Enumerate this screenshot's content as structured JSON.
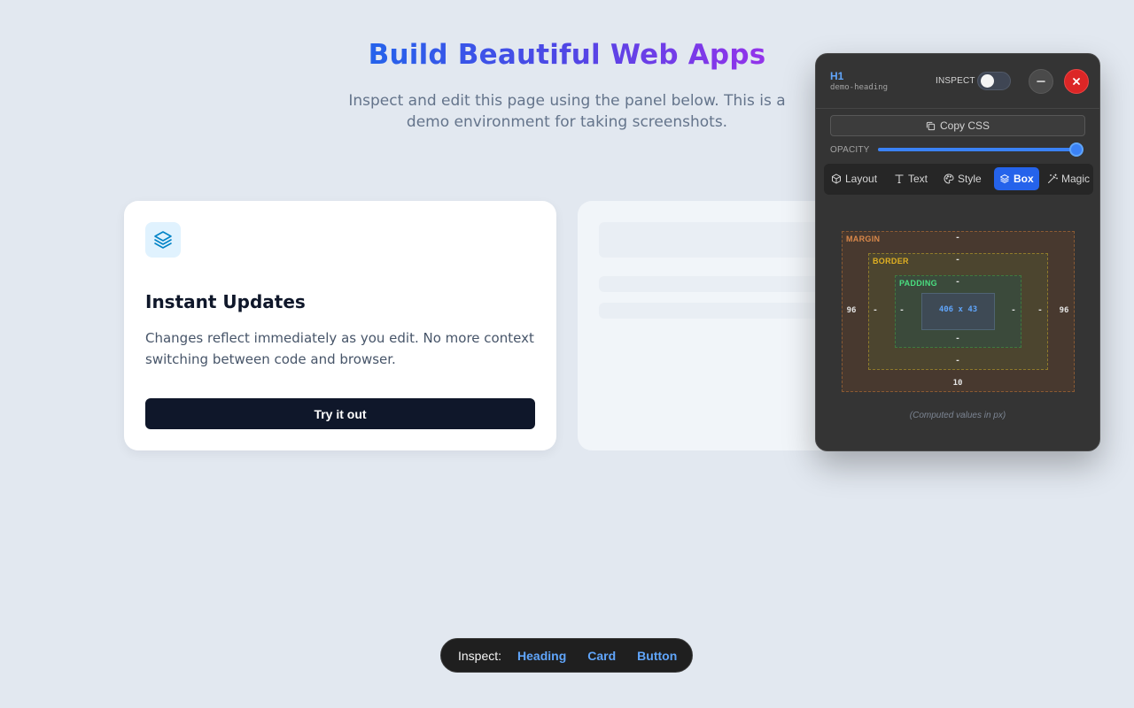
{
  "hero": {
    "title": "Build Beautiful Web Apps",
    "subtitle": "Inspect and edit this page using the panel below. This is a demo environment for taking screenshots."
  },
  "card": {
    "icon": "layers-icon",
    "title": "Instant Updates",
    "text": "Changes reflect immediately as you edit. No more context switching between code and browser.",
    "button_label": "Try it out"
  },
  "inspector": {
    "element_tag": "H1",
    "element_id": "demo-heading",
    "inspect_label": "INSPECT",
    "inspect_enabled": false,
    "copy_css_label": "Copy CSS",
    "opacity_label": "OPACITY",
    "opacity_value": 1.0,
    "tabs": [
      {
        "label": "Layout",
        "icon": "cube-icon",
        "active": false
      },
      {
        "label": "Text",
        "icon": "type-icon",
        "active": false
      },
      {
        "label": "Style",
        "icon": "palette-icon",
        "active": false
      },
      {
        "label": "Box",
        "icon": "layers-icon",
        "active": true
      },
      {
        "label": "Magic",
        "icon": "wand-icon",
        "active": false
      }
    ],
    "box_model": {
      "margin_label": "MARGIN",
      "border_label": "BORDER",
      "padding_label": "PADDING",
      "margin": {
        "top": "-",
        "right": "96",
        "bottom": "10",
        "left": "96"
      },
      "border": {
        "top": "-",
        "right": "-",
        "bottom": "-",
        "left": "-"
      },
      "padding": {
        "top": "-",
        "right": "-",
        "bottom": "-",
        "left": "-"
      },
      "content": "406 x 43",
      "note": "(Computed values in px)"
    },
    "colors": {
      "accent": "#2563eb",
      "margin": "#d9884a",
      "border": "#e0b022",
      "padding": "#4ade80",
      "content": "#60a5fa",
      "close": "#dc2626"
    }
  },
  "bottom_bar": {
    "label": "Inspect:",
    "links": [
      "Heading",
      "Card",
      "Button"
    ]
  }
}
